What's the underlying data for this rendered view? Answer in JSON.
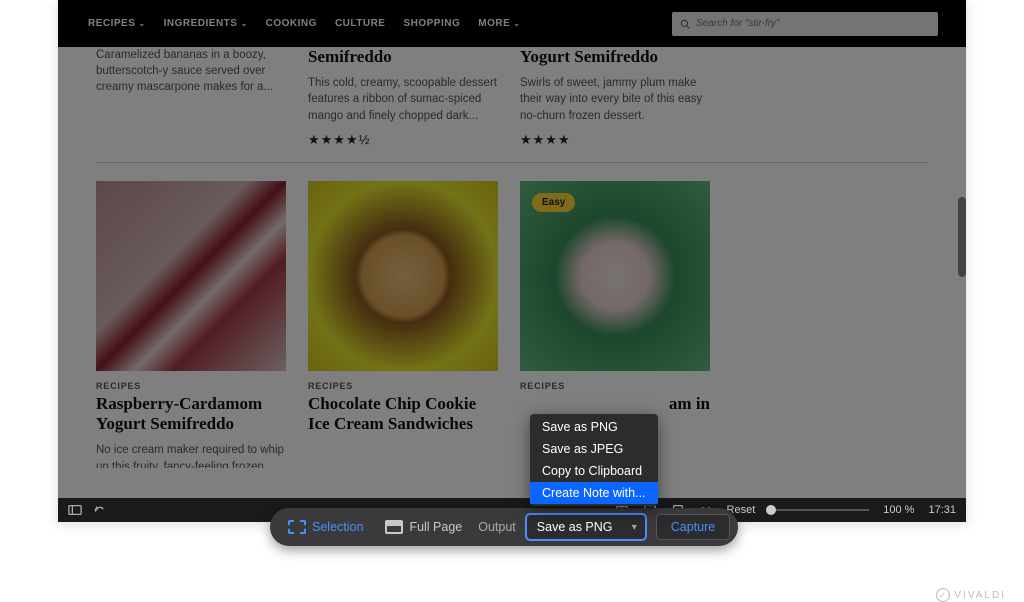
{
  "nav": {
    "items": [
      "RECIPES",
      "INGREDIENTS",
      "COOKING",
      "CULTURE",
      "SHOPPING",
      "MORE"
    ],
    "search_placeholder": "Search for \"stir-fry\""
  },
  "row1": [
    {
      "desc": "Caramelized bananas in a boozy, butterscotch-y sauce served over creamy mascarpone makes for a..."
    },
    {
      "title": "Semifreddo",
      "desc": "This cold, creamy, scoopable dessert features a ribbon of sumac-spiced mango and finely chopped dark...",
      "stars": "★★★★½"
    },
    {
      "title": "Yogurt Semifreddo",
      "desc": "Swirls of sweet, jammy plum make their way into every bite of this easy no-churn frozen dessert.",
      "stars": "★★★★"
    }
  ],
  "row2": [
    {
      "cat": "RECIPES",
      "title": "Raspberry-Cardamom Yogurt Semifreddo",
      "desc": "No ice cream maker required to whip up this fruity, fancy-feeling frozen dessert."
    },
    {
      "cat": "RECIPES",
      "title": "Chocolate Chip Cookie Ice Cream Sandwiches",
      "desc": ""
    },
    {
      "cat": "RECIPES",
      "title_partial": "am in",
      "badge": "Easy"
    }
  ],
  "capture": {
    "selection": "Selection",
    "fullpage": "Full Page",
    "output_label": "Output",
    "selected": "Save as PNG",
    "capture_btn": "Capture"
  },
  "dropdown": {
    "items": [
      "Save as PNG",
      "Save as JPEG",
      "Copy to Clipboard",
      "Create Note with..."
    ],
    "highlighted_index": 3
  },
  "status": {
    "reset": "Reset",
    "zoom": "100 %",
    "time": "17:31"
  },
  "branding": "VIVALDI"
}
